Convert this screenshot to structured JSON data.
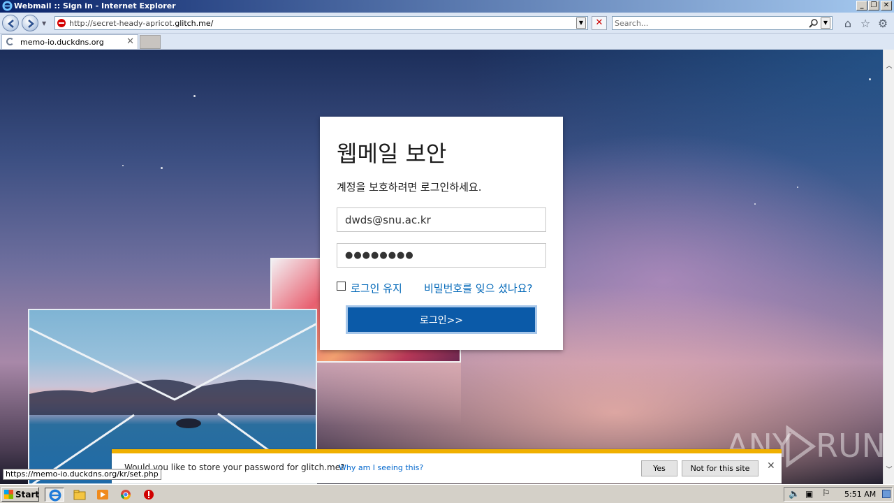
{
  "window": {
    "title": "Webmail :: Sign in - Internet Explorer"
  },
  "navbar": {
    "url_prefix": "http://secret-heady-apricot.",
    "url_domain": "glitch.me/",
    "search_placeholder": "Search..."
  },
  "tabs": [
    {
      "label": "memo-io.duckdns.org"
    }
  ],
  "login": {
    "title": "웹메일 보안",
    "subtitle": "계정을 보호하려면 로그인하세요.",
    "email_value": "dwds@snu.ac.kr",
    "password_mask": "●●●●●●●●",
    "remember_label": "로그인 유지",
    "forgot_label": "비밀번호를 잊으 셨나요?",
    "button_label": "로그인>>"
  },
  "password_bar": {
    "message": "Would you like to store your password for glitch.me?",
    "why_link": "Why am I seeing this?",
    "yes_label": "Yes",
    "not_label": "Not for this site"
  },
  "status_link": "https://memo-io.duckdns.org/kr/set.php",
  "watermark": {
    "left": "ANY",
    "right": "RUN"
  },
  "taskbar": {
    "start_label": "Start",
    "clock": "5:51 AM"
  },
  "colors": {
    "accent": "#0b5aa8",
    "link": "#0067b8",
    "infobar": "#f0b000"
  }
}
